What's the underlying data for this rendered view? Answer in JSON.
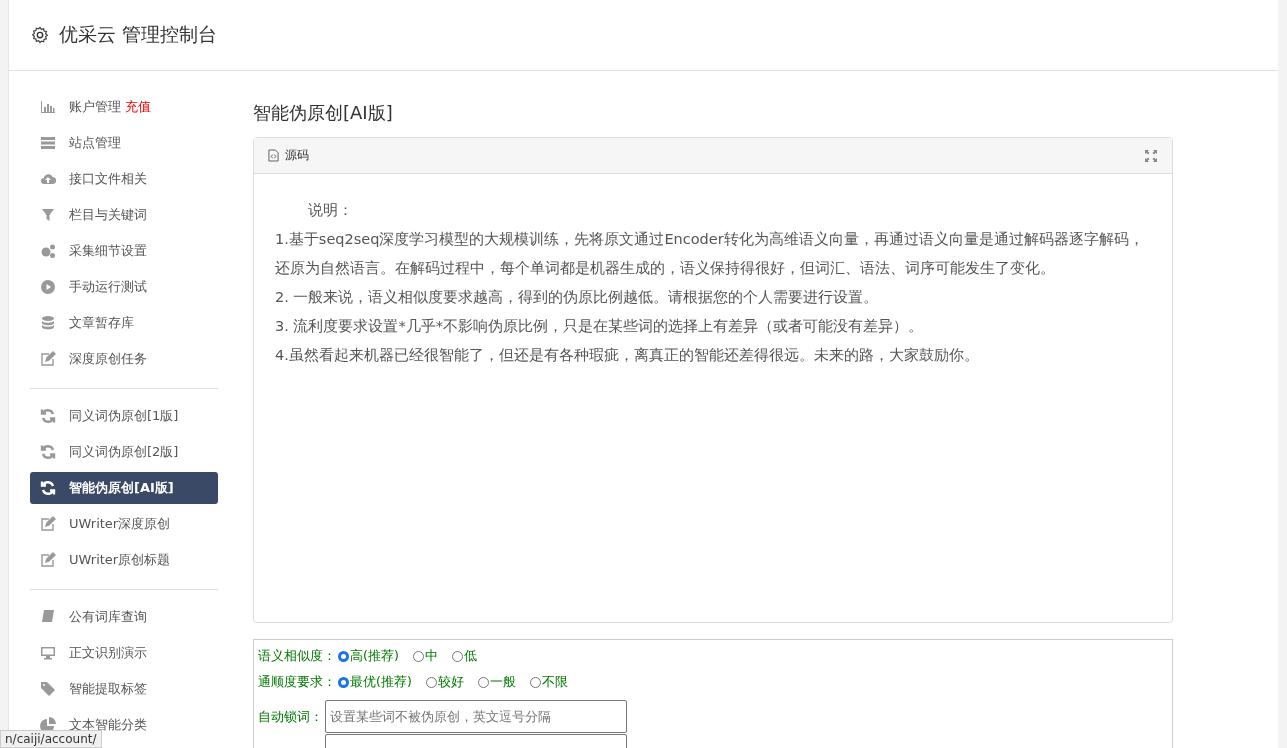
{
  "header": {
    "title": "优采云 管理控制台"
  },
  "sidebar": {
    "groups": [
      {
        "items": [
          {
            "label": "账户管理",
            "badge": "充值",
            "selected": false
          },
          {
            "label": "站点管理",
            "selected": false
          },
          {
            "label": "接口文件相关",
            "selected": false
          },
          {
            "label": "栏目与关键词",
            "selected": false
          },
          {
            "label": "采集细节设置",
            "selected": false
          },
          {
            "label": "手动运行测试",
            "selected": false
          },
          {
            "label": "文章暂存库",
            "selected": false
          },
          {
            "label": "深度原创任务",
            "selected": false
          }
        ]
      },
      {
        "items": [
          {
            "label": "同义词伪原创[1版]",
            "selected": false
          },
          {
            "label": "同义词伪原创[2版]",
            "selected": false
          },
          {
            "label": "智能伪原创[AI版]",
            "selected": true
          },
          {
            "label": "UWriter深度原创",
            "selected": false
          },
          {
            "label": "UWriter原创标题",
            "selected": false
          }
        ]
      },
      {
        "items": [
          {
            "label": "公有词库查询",
            "selected": false
          },
          {
            "label": "正文识别演示",
            "selected": false
          },
          {
            "label": "智能提取标签",
            "selected": false
          },
          {
            "label": "文本智能分类",
            "selected": false
          }
        ]
      }
    ]
  },
  "page_title": "智能伪原创[AI版]",
  "editor": {
    "toolbar_label": "源码",
    "heading": "说明：",
    "paragraphs": [
      "1.基于seq2seq深度学习模型的大规模训练，先将原文通过Encoder转化为高维语义向量，再通过语义向量是通过解码器逐字解码，还原为自然语言。在解码过程中，每个单词都是机器生成的，语义保持得很好，但词汇、语法、词序可能发生了变化。",
      "2. 一般来说，语义相似度要求越高，得到的伪原比例越低。请根据您的个人需要进行设置。",
      "3. 流利度要求设置*几乎*不影响伪原比例，只是在某些词的选择上有差异（或者可能没有差异）。",
      "4.虽然看起来机器已经很智能了，但还是有各种瑕疵，离真正的智能还差得很远。未来的路，大家鼓励你。"
    ]
  },
  "options": [
    {
      "label": "语义相似度：",
      "choices": [
        {
          "label": "高(推荐)",
          "selected": true
        },
        {
          "label": "中",
          "selected": false
        },
        {
          "label": "低",
          "selected": false
        }
      ]
    },
    {
      "label": "通顺度要求：",
      "choices": [
        {
          "label": "最优(推荐)",
          "selected": true
        },
        {
          "label": "较好",
          "selected": false
        },
        {
          "label": "一般",
          "selected": false
        },
        {
          "label": "不限",
          "selected": false
        }
      ]
    }
  ],
  "lock_words": {
    "label": "自动锁词：",
    "placeholder": "设置某些词不被伪原创，英文逗号分隔"
  },
  "status_url": "n/caiji/account/"
}
